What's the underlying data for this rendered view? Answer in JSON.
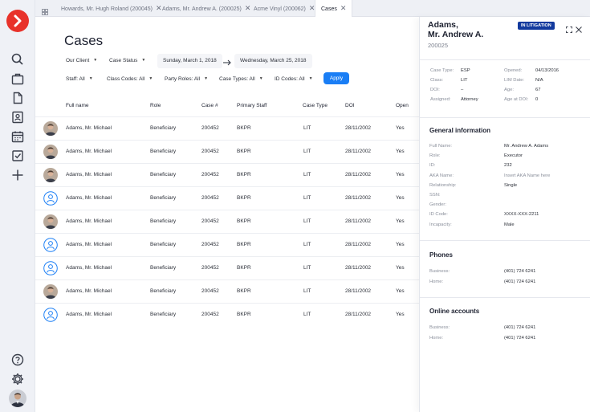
{
  "tabs": [
    {
      "label": "Howards, Mr. Hugh Roland (200045)"
    },
    {
      "label": "Adams, Mr. Andrew A. (200025)"
    },
    {
      "label": "Acme Vinyl (200062)"
    },
    {
      "label": "Cases"
    }
  ],
  "page": {
    "title": "Cases"
  },
  "filters": {
    "our_client": "Our Client",
    "case_status": "Case Status",
    "date_from": "Sunday, March 1, 2018",
    "date_to": "Wednesday, March 25, 2018",
    "staff": "Staff: All",
    "class_codes": "Class Codes: All",
    "party_roles": "Party Roles: All",
    "case_types": "Case Types: All",
    "id_codes": "ID Codes: All",
    "apply": "Apply"
  },
  "table": {
    "headers": [
      "Full name",
      "Role",
      "Case #",
      "Primary Staff",
      "Case Type",
      "DOI",
      "Open"
    ],
    "rows": [
      {
        "name": "Adams, Mr. Michael",
        "role": "Beneficiary",
        "case": "200452",
        "staff": "BKPR",
        "type": "LIT",
        "doi": "28/11/2002",
        "open": "Yes",
        "avatar": "photo"
      },
      {
        "name": "Adams, Mr. Michael",
        "role": "Beneficiary",
        "case": "200452",
        "staff": "BKPR",
        "type": "LIT",
        "doi": "28/11/2002",
        "open": "Yes",
        "avatar": "photo"
      },
      {
        "name": "Adams, Mr. Michael",
        "role": "Beneficiary",
        "case": "200452",
        "staff": "BKPR",
        "type": "LIT",
        "doi": "28/11/2002",
        "open": "Yes",
        "avatar": "photo"
      },
      {
        "name": "Adams, Mr. Michael",
        "role": "Beneficiary",
        "case": "200452",
        "staff": "BKPR",
        "type": "LIT",
        "doi": "28/11/2002",
        "open": "Yes",
        "avatar": "placeholder"
      },
      {
        "name": "Adams, Mr. Michael",
        "role": "Beneficiary",
        "case": "200452",
        "staff": "BKPR",
        "type": "LIT",
        "doi": "28/11/2002",
        "open": "Yes",
        "avatar": "photo"
      },
      {
        "name": "Adams, Mr. Michael",
        "role": "Beneficiary",
        "case": "200452",
        "staff": "BKPR",
        "type": "LIT",
        "doi": "28/11/2002",
        "open": "Yes",
        "avatar": "placeholder"
      },
      {
        "name": "Adams, Mr. Michael",
        "role": "Beneficiary",
        "case": "200452",
        "staff": "BKPR",
        "type": "LIT",
        "doi": "28/11/2002",
        "open": "Yes",
        "avatar": "placeholder"
      },
      {
        "name": "Adams, Mr. Michael",
        "role": "Beneficiary",
        "case": "200452",
        "staff": "BKPR",
        "type": "LIT",
        "doi": "28/11/2002",
        "open": "Yes",
        "avatar": "photo"
      },
      {
        "name": "Adams, Mr. Michael",
        "role": "Beneficiary",
        "case": "200452",
        "staff": "BKPR",
        "type": "LIT",
        "doi": "28/11/2002",
        "open": "Yes",
        "avatar": "placeholder"
      }
    ]
  },
  "panel": {
    "name_line1": "Adams,",
    "name_line2": "Mr. Andrew A.",
    "id": "200025",
    "badge": "IN LITIGATION",
    "summary": {
      "case_type_label": "Case Type:",
      "case_type": "ESP",
      "class_label": "Class:",
      "class": "LIT",
      "doi_label": "DOI:",
      "doi": "–",
      "assigned_label": "Assigned:",
      "assigned": "Attorney",
      "opened_label": "Opened:",
      "opened": "04/13/2016",
      "lim_label": "LIM Date:",
      "lim": "N/A",
      "age_label": "Age:",
      "age": "67",
      "age_doi_label": "Age at DOI:",
      "age_doi": "0"
    },
    "general": {
      "title": "General information",
      "items": [
        {
          "label": "Full Name:",
          "value": "Mr. Andrew A. Adams"
        },
        {
          "label": "Role:",
          "value": "Executor"
        },
        {
          "label": "ID:",
          "value": "232"
        },
        {
          "label": "AKA Name:",
          "value": "Insert AKA Name here"
        },
        {
          "label": "Relationship:",
          "value": "Single"
        },
        {
          "label": "SSN:",
          "value": ""
        },
        {
          "label": "Gender:",
          "value": ""
        },
        {
          "label": "ID Code:",
          "value": "XXXX-XXX-2211"
        },
        {
          "label": "Incapacity:",
          "value": "Male"
        }
      ]
    },
    "phones": {
      "title": "Phones",
      "items": [
        {
          "label": "Business:",
          "value": "(401) 724 6241"
        },
        {
          "label": "Home:",
          "value": "(401) 724 6241"
        }
      ]
    },
    "online": {
      "title": "Online accounts",
      "items": [
        {
          "label": "Business:",
          "value": "(401) 724 6241"
        },
        {
          "label": "Home:",
          "value": "(401) 724 6241"
        }
      ]
    }
  },
  "colors": {
    "brand": "#e8322a",
    "accent": "#1a7ef5",
    "badge": "#123a9e"
  }
}
